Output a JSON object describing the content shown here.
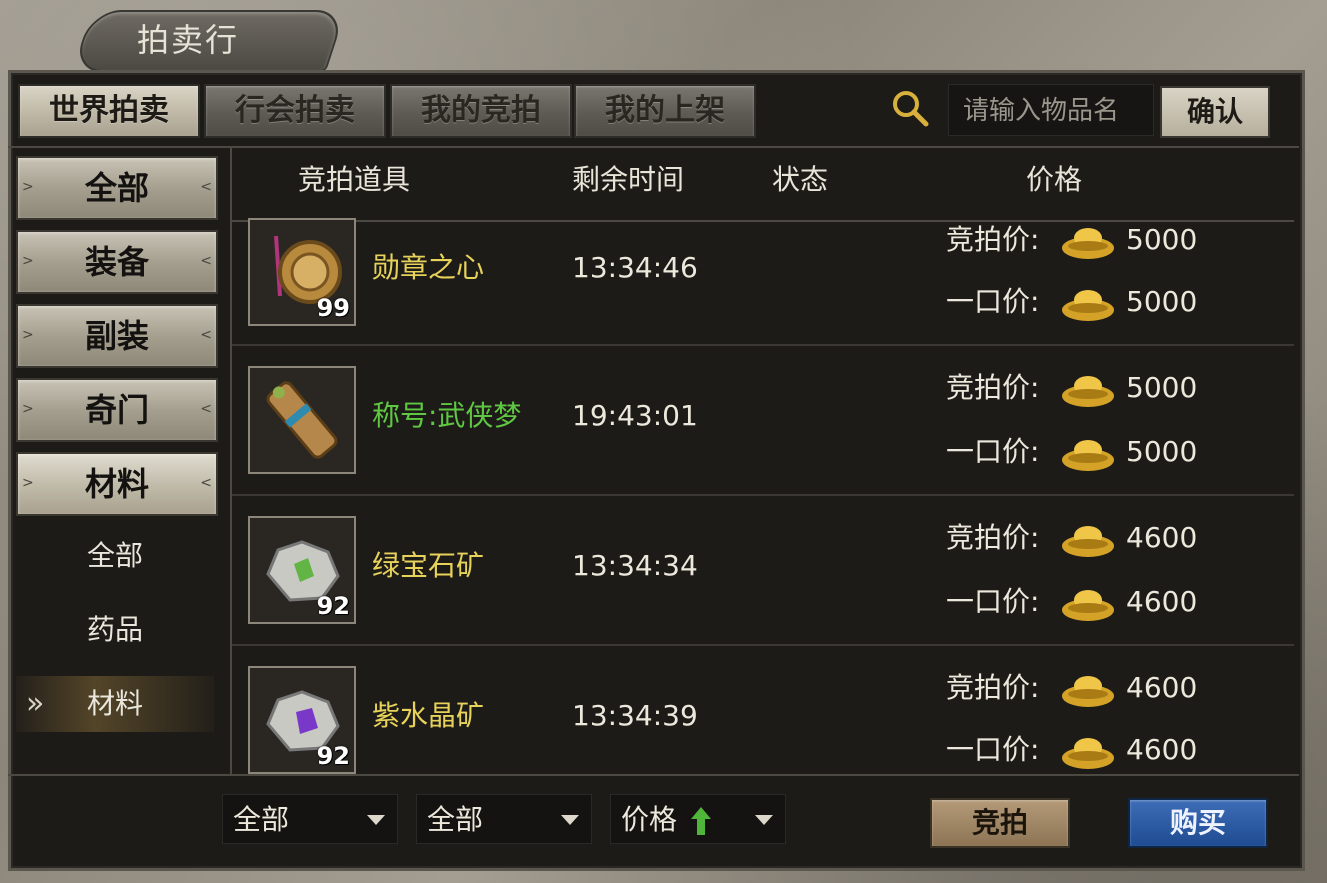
{
  "window": {
    "title": "拍卖行"
  },
  "tabs": [
    {
      "label": "世界拍卖",
      "active": true
    },
    {
      "label": "行会拍卖",
      "active": false
    },
    {
      "label": "我的竞拍",
      "active": false
    },
    {
      "label": "我的上架",
      "active": false
    }
  ],
  "search": {
    "placeholder": "请输入物品名",
    "confirm_label": "确认",
    "icon": "search-icon"
  },
  "sidebar": {
    "categories": [
      {
        "label": "全部"
      },
      {
        "label": "装备"
      },
      {
        "label": "副装"
      },
      {
        "label": "奇门"
      },
      {
        "label": "材料",
        "active": true
      }
    ],
    "subcategories": [
      {
        "label": "全部"
      },
      {
        "label": "药品"
      },
      {
        "label": "材料",
        "selected": true
      }
    ],
    "selected_marker": "»"
  },
  "columns": {
    "item": "竞拍道具",
    "time": "剩余时间",
    "status": "状态",
    "price": "价格"
  },
  "price_labels": {
    "bid": "竞拍价:",
    "buyout": "一口价:"
  },
  "currency_icon": "gold-ingot-icon",
  "items": [
    {
      "name": "勋章之心",
      "name_color": "#e7d25a",
      "stack": "99",
      "time": "13:34:46",
      "bid": "5000",
      "buyout": "5000",
      "icon": "medal-icon"
    },
    {
      "name": "称号:武侠梦",
      "name_color": "#5fc742",
      "stack": "",
      "time": "19:43:01",
      "bid": "5000",
      "buyout": "5000",
      "icon": "scroll-icon"
    },
    {
      "name": "绿宝石矿",
      "name_color": "#e7d25a",
      "stack": "92",
      "time": "13:34:34",
      "bid": "4600",
      "buyout": "4600",
      "icon": "emerald-ore-icon"
    },
    {
      "name": "紫水晶矿",
      "name_color": "#e7d25a",
      "stack": "92",
      "time": "13:34:39",
      "bid": "4600",
      "buyout": "4600",
      "icon": "amethyst-ore-icon"
    }
  ],
  "filters": [
    {
      "value": "全部"
    },
    {
      "value": "全部"
    },
    {
      "value": "价格"
    }
  ],
  "actions": {
    "bid_label": "竞拍",
    "buy_label": "购买"
  }
}
